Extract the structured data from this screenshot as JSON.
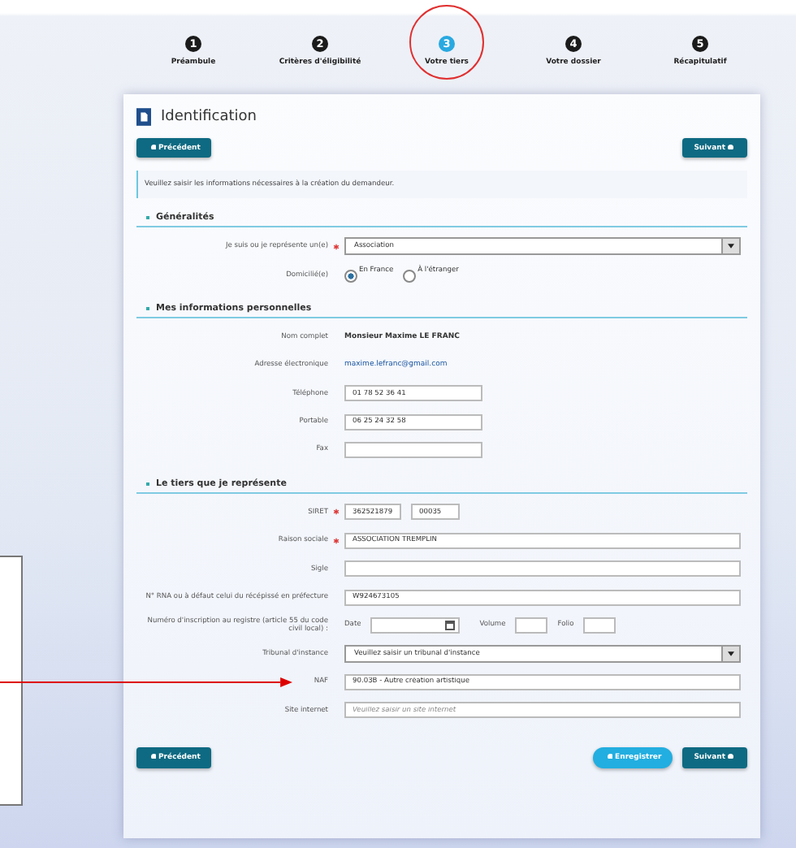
{
  "steps": [
    {
      "number": "1",
      "label": "Préambule",
      "selected": false
    },
    {
      "number": "2",
      "label": "Critères d'éligibilité",
      "selected": false
    },
    {
      "number": "3",
      "label": "Votre tiers",
      "selected": true
    },
    {
      "number": "4",
      "label": "Votre dossier",
      "selected": false
    },
    {
      "number": "5",
      "label": "Récapitulatif",
      "selected": false
    }
  ],
  "card": {
    "title": "Identification",
    "top_buttons": [
      {
        "label": "Précédent",
        "kind": "prev"
      },
      {
        "label": "Suivant",
        "kind": "next"
      }
    ],
    "info": "Veuillez saisir les informations nécessaires à la création du demandeur.",
    "sections": [
      {
        "title": "Généralités",
        "rows": [
          {
            "kind": "select",
            "label": "Je suis ou je représente un(e)",
            "required": true,
            "value": "Association"
          },
          {
            "kind": "radio",
            "label": "Domicilié(e)",
            "options": [
              {
                "label": "En France",
                "selected": true
              },
              {
                "label": "À l'étranger",
                "selected": false
              }
            ]
          }
        ]
      },
      {
        "title": "Mes informations personnelles",
        "rows": [
          {
            "kind": "static",
            "label": "Nom complet",
            "value": "Monsieur Maxime LE FRANC"
          },
          {
            "kind": "email",
            "label": "Adresse électronique",
            "value": "maxime.lefranc@gmail.com"
          },
          {
            "kind": "input",
            "wide": false,
            "label": "Téléphone",
            "value": "01 78 52 36 41"
          },
          {
            "kind": "input",
            "wide": false,
            "label": "Portable",
            "value": "06 25 24 32 58"
          },
          {
            "kind": "input",
            "wide": false,
            "label": "Fax"
          }
        ]
      },
      {
        "title": "Le tiers que je représente",
        "rows": [
          {
            "kind": "siret",
            "label": "SIRET",
            "required": true,
            "values": [
              "362521879",
              "00035"
            ]
          },
          {
            "kind": "input",
            "wide": true,
            "label": "Raison sociale",
            "required": true,
            "value": "ASSOCIATION TREMPLIN"
          },
          {
            "kind": "input",
            "wide": true,
            "label": "Sigle"
          },
          {
            "kind": "input",
            "wide": true,
            "label": "N° RNA ou à défaut celui du récépissé en préfecture",
            "value": "W924673105"
          },
          {
            "kind": "register",
            "label": "Numéro d'inscription au registre (article 55 du code civil local) :",
            "fields": [
              "Date",
              "Volume",
              "Folio"
            ]
          },
          {
            "kind": "select",
            "label": "Tribunal d'instance",
            "value": "Veuillez saisir un tribunal d'instance"
          },
          {
            "kind": "input",
            "wide": true,
            "label": "NAF",
            "value": "90.03B - Autre création artistique",
            "pointed": true
          },
          {
            "kind": "input",
            "wide": true,
            "label": "Site internet",
            "placeholder": "Veuillez saisir un site internet"
          }
        ]
      }
    ],
    "bottom_buttons": [
      {
        "label": "Précédent",
        "kind": "prev"
      },
      {
        "label": "Enregistrer",
        "kind": "save"
      },
      {
        "label": "Suivant",
        "kind": "next"
      }
    ]
  }
}
